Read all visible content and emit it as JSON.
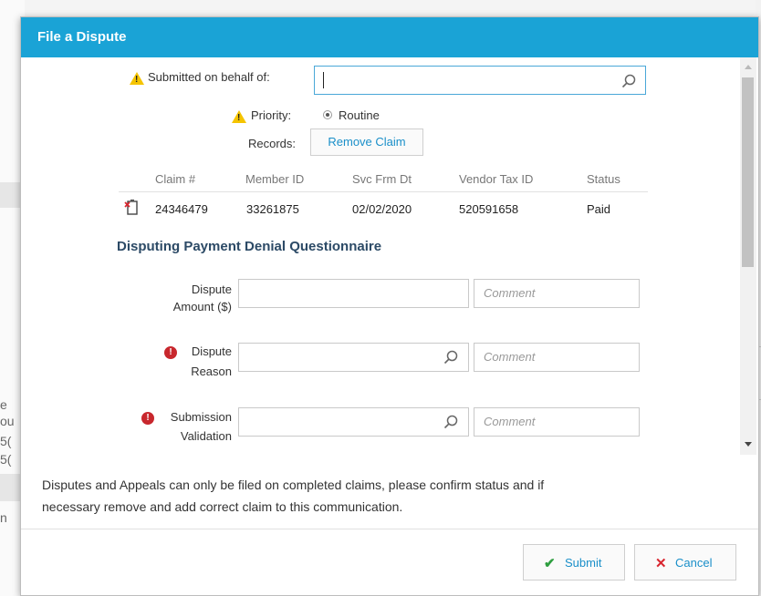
{
  "dialog": {
    "title": "File a Dispute"
  },
  "form": {
    "submitted_on_behalf_label": "Submitted on behalf of:",
    "submitted_on_behalf_value": "",
    "priority_label": "Priority:",
    "priority_option": "Routine",
    "records_label": "Records:",
    "remove_claim_label": "Remove Claim"
  },
  "claims_table": {
    "headers": [
      "Claim #",
      "Member ID",
      "Svc Frm Dt",
      "Vendor Tax ID",
      "Status"
    ],
    "rows": [
      [
        "24346479",
        "33261875",
        "02/02/2020",
        "520591658",
        "Paid"
      ]
    ]
  },
  "questionnaire": {
    "title": "Disputing Payment Denial Questionnaire",
    "fields": [
      {
        "label_line1": "Dispute",
        "label_line2": "Amount ($)",
        "comment_placeholder": "Comment",
        "required": false,
        "searchable": false
      },
      {
        "label_line1": "Dispute",
        "label_line2": "Reason",
        "comment_placeholder": "Comment",
        "required": true,
        "searchable": true
      },
      {
        "label_line1": "Submission",
        "label_line2": "Validation",
        "comment_placeholder": "Comment",
        "required": true,
        "searchable": true
      }
    ]
  },
  "notice": {
    "line1": "Disputes and Appeals can only be filed on completed claims, please confirm status and if",
    "line2": "necessary remove and add correct claim to this communication."
  },
  "buttons": {
    "submit": "Submit",
    "cancel": "Cancel"
  },
  "background": {
    "fragments": [
      "e",
      "ou",
      "5(",
      "5("
    ],
    "bottom_fragment": "n"
  },
  "colors": {
    "header": "#1aa3d6",
    "section_title": "#2c4a66",
    "link": "#1a8fc9",
    "submit_icon": "#2e9e3f",
    "cancel_icon": "#d9262f",
    "warning": "#f5c400",
    "error": "#c8272d"
  },
  "icons": {
    "warning": "warning-icon",
    "error": "error-icon",
    "search": "search-icon",
    "document": "document-remove-icon",
    "check": "check-icon",
    "close": "close-icon"
  }
}
